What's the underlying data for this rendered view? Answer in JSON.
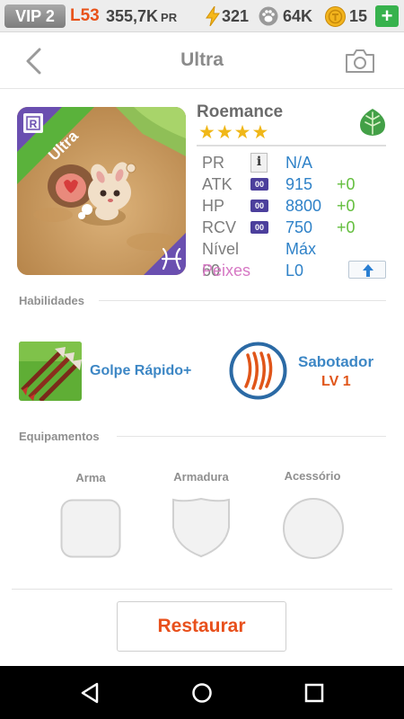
{
  "status_bar": {
    "vip": "VIP 2",
    "level": "L53",
    "pr_amount": "355,7K",
    "pr_unit": "PR",
    "energy": "321",
    "paw": "64K",
    "coins": "15",
    "plus": "+"
  },
  "header": {
    "title": "Ultra",
    "back_icon": "chevron-left-icon",
    "camera_icon": "camera-icon"
  },
  "pet": {
    "rarity": "Ultra",
    "rarity_badge": "R",
    "name": "Roemance",
    "stars": 4,
    "element_icon": "leaf-icon",
    "zodiac_icon": "pisces-icon",
    "stats": [
      {
        "label": "PR",
        "badge": "i",
        "value": "N/A",
        "bonus": ""
      },
      {
        "label": "ATK",
        "badge": "00",
        "value": "915",
        "bonus": "+0"
      },
      {
        "label": "HP",
        "badge": "00",
        "value": "8800",
        "bonus": "+0"
      },
      {
        "label": "RCV",
        "badge": "00",
        "value": "750",
        "bonus": "+0"
      },
      {
        "label": "Nível 60",
        "badge": "",
        "value": "Máx",
        "bonus": ""
      },
      {
        "label": "Peixes",
        "badge": "",
        "value": "L0",
        "bonus": ""
      }
    ]
  },
  "abilities": {
    "heading": "Habilidades",
    "active": {
      "name": "Golpe Rápido+"
    },
    "passive": {
      "name": "Sabotador",
      "level": "LV 1"
    }
  },
  "equipment": {
    "heading": "Equipamentos",
    "slots": [
      "Arma",
      "Armadura",
      "Acessório"
    ]
  },
  "restore_label": "Restaurar",
  "colors": {
    "accent_orange": "#e8501c",
    "stat_blue": "#2f82c8",
    "bonus_green": "#63be3d",
    "ultra_green": "#5ab23b"
  }
}
